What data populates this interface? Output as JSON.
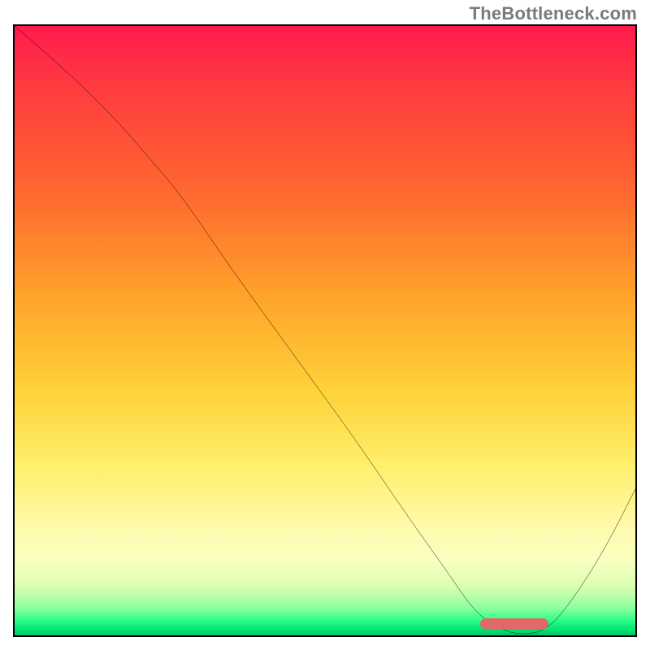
{
  "watermark": "TheBottleneck.com",
  "chart_data": {
    "type": "line",
    "title": "",
    "xlabel": "",
    "ylabel": "",
    "xlim": [
      0,
      100
    ],
    "ylim": [
      0,
      100
    ],
    "grid": false,
    "background": "red-yellow-green-vertical-gradient",
    "series": [
      {
        "name": "bottleneck-curve",
        "x": [
          0,
          8,
          16,
          22,
          27,
          35,
          45,
          55,
          63,
          70,
          74,
          78,
          82,
          86,
          90,
          95,
          100
        ],
        "y": [
          100,
          93,
          85,
          78,
          72,
          60,
          46,
          32,
          20,
          10,
          4,
          1,
          0,
          1,
          6,
          14,
          24
        ]
      }
    ],
    "optimal_marker": {
      "x_start": 75,
      "x_end": 86,
      "y": 1
    },
    "colors": {
      "curve": "#000000",
      "border": "#000000",
      "marker": "#e06a6a",
      "watermark": "#7a7a7a",
      "gradient_stops": [
        "#ff1a4d",
        "#ffa52a",
        "#ffef6a",
        "#00e676"
      ]
    }
  }
}
